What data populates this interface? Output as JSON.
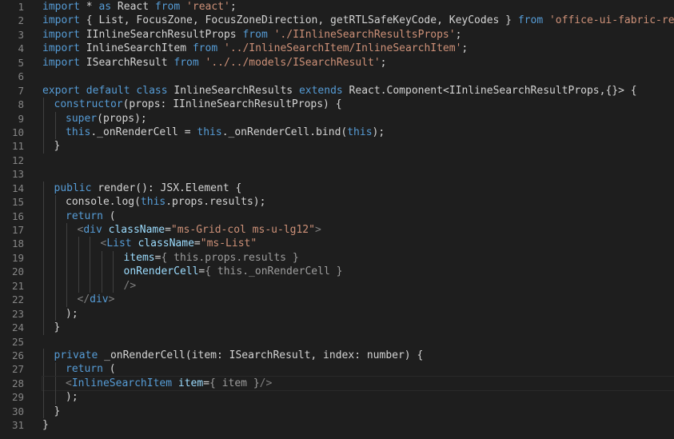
{
  "editor": {
    "lines": [
      {
        "n": "1",
        "indent": 0,
        "tokens": [
          [
            "kw",
            "import"
          ],
          [
            "plain",
            " * "
          ],
          [
            "kw",
            "as"
          ],
          [
            "plain",
            " React "
          ],
          [
            "kw",
            "from"
          ],
          [
            "plain",
            " "
          ],
          [
            "str",
            "'react'"
          ],
          [
            "plain",
            ";"
          ]
        ]
      },
      {
        "n": "2",
        "indent": 0,
        "tokens": [
          [
            "kw",
            "import"
          ],
          [
            "plain",
            " { List, FocusZone, FocusZoneDirection, getRTLSafeKeyCode, KeyCodes } "
          ],
          [
            "kw",
            "from"
          ],
          [
            "plain",
            " "
          ],
          [
            "str",
            "'office-ui-fabric-react'"
          ],
          [
            "plain",
            ";"
          ]
        ]
      },
      {
        "n": "3",
        "indent": 0,
        "tokens": [
          [
            "kw",
            "import"
          ],
          [
            "plain",
            " IInlineSearchResultProps "
          ],
          [
            "kw",
            "from"
          ],
          [
            "plain",
            " "
          ],
          [
            "str",
            "'./IInlineSearchResultsProps'"
          ],
          [
            "plain",
            ";"
          ]
        ]
      },
      {
        "n": "4",
        "indent": 0,
        "tokens": [
          [
            "kw",
            "import"
          ],
          [
            "plain",
            " InlineSearchItem "
          ],
          [
            "kw",
            "from"
          ],
          [
            "plain",
            " "
          ],
          [
            "str",
            "'../InlineSearchItem/InlineSearchItem'"
          ],
          [
            "plain",
            ";"
          ]
        ]
      },
      {
        "n": "5",
        "indent": 0,
        "tokens": [
          [
            "kw",
            "import"
          ],
          [
            "plain",
            " ISearchResult "
          ],
          [
            "kw",
            "from"
          ],
          [
            "plain",
            " "
          ],
          [
            "str",
            "'../../models/ISearchResult'"
          ],
          [
            "plain",
            ";"
          ]
        ]
      },
      {
        "n": "6",
        "indent": 0,
        "tokens": []
      },
      {
        "n": "7",
        "indent": 0,
        "tokens": [
          [
            "kw",
            "export"
          ],
          [
            "plain",
            " "
          ],
          [
            "kw",
            "default"
          ],
          [
            "plain",
            " "
          ],
          [
            "kw",
            "class"
          ],
          [
            "plain",
            " InlineSearchResults "
          ],
          [
            "kw",
            "extends"
          ],
          [
            "plain",
            " React.Component<IInlineSearchResultProps,{}> {"
          ]
        ]
      },
      {
        "n": "8",
        "indent": 1,
        "tokens": [
          [
            "kw",
            "constructor"
          ],
          [
            "plain",
            "(props: IInlineSearchResultProps) {"
          ]
        ]
      },
      {
        "n": "9",
        "indent": 2,
        "tokens": [
          [
            "kw",
            "super"
          ],
          [
            "plain",
            "(props);"
          ]
        ]
      },
      {
        "n": "10",
        "indent": 2,
        "tokens": [
          [
            "kw",
            "this"
          ],
          [
            "plain",
            "._onRenderCell = "
          ],
          [
            "kw",
            "this"
          ],
          [
            "plain",
            "._onRenderCell.bind("
          ],
          [
            "kw",
            "this"
          ],
          [
            "plain",
            ");"
          ]
        ]
      },
      {
        "n": "11",
        "indent": 1,
        "tokens": [
          [
            "plain",
            "}"
          ]
        ]
      },
      {
        "n": "12",
        "indent": 0,
        "tokens": []
      },
      {
        "n": "13",
        "indent": 0,
        "tokens": []
      },
      {
        "n": "14",
        "indent": 1,
        "tokens": [
          [
            "kw",
            "public"
          ],
          [
            "plain",
            " render(): JSX.Element {"
          ]
        ]
      },
      {
        "n": "15",
        "indent": 2,
        "tokens": [
          [
            "plain",
            "console.log("
          ],
          [
            "kw",
            "this"
          ],
          [
            "plain",
            ".props.results);"
          ]
        ]
      },
      {
        "n": "16",
        "indent": 2,
        "tokens": [
          [
            "kw",
            "return"
          ],
          [
            "plain",
            " ("
          ]
        ]
      },
      {
        "n": "17",
        "indent": 3,
        "tokens": [
          [
            "tagb",
            "<"
          ],
          [
            "tag",
            "div"
          ],
          [
            "plain",
            " "
          ],
          [
            "attr",
            "className"
          ],
          [
            "plain",
            "="
          ],
          [
            "str",
            "\"ms-Grid-col ms-u-lg12\""
          ],
          [
            "tagb",
            ">"
          ]
        ]
      },
      {
        "n": "18",
        "indent": 5,
        "tokens": [
          [
            "tagb",
            "<"
          ],
          [
            "tag",
            "List"
          ],
          [
            "plain",
            " "
          ],
          [
            "attr",
            "className"
          ],
          [
            "plain",
            "="
          ],
          [
            "str",
            "\"ms-List\""
          ]
        ]
      },
      {
        "n": "19",
        "indent": 7,
        "tokens": [
          [
            "attr",
            "items"
          ],
          [
            "plain",
            "="
          ],
          [
            "dim",
            "{ this.props.results }"
          ]
        ]
      },
      {
        "n": "20",
        "indent": 7,
        "tokens": [
          [
            "attr",
            "onRenderCell"
          ],
          [
            "plain",
            "="
          ],
          [
            "dim",
            "{ this._onRenderCell }"
          ]
        ]
      },
      {
        "n": "21",
        "indent": 7,
        "tokens": [
          [
            "tagb",
            "/>"
          ]
        ]
      },
      {
        "n": "22",
        "indent": 3,
        "tokens": [
          [
            "tagb",
            "</"
          ],
          [
            "tag",
            "div"
          ],
          [
            "tagb",
            ">"
          ]
        ]
      },
      {
        "n": "23",
        "indent": 2,
        "tokens": [
          [
            "plain",
            ");"
          ]
        ]
      },
      {
        "n": "24",
        "indent": 1,
        "tokens": [
          [
            "plain",
            "}"
          ]
        ]
      },
      {
        "n": "25",
        "indent": 0,
        "tokens": []
      },
      {
        "n": "26",
        "indent": 1,
        "tokens": [
          [
            "kw",
            "private"
          ],
          [
            "plain",
            " _onRenderCell(item: ISearchResult, index: number) {"
          ]
        ]
      },
      {
        "n": "27",
        "indent": 2,
        "tokens": [
          [
            "kw",
            "return"
          ],
          [
            "plain",
            " ("
          ]
        ]
      },
      {
        "n": "28",
        "indent": 2,
        "cursor": true,
        "tokens": [
          [
            "tagb",
            "<"
          ],
          [
            "tag",
            "InlineSearchItem"
          ],
          [
            "plain",
            " "
          ],
          [
            "attr",
            "item"
          ],
          [
            "plain",
            "="
          ],
          [
            "dim",
            "{ item }"
          ],
          [
            "tagb",
            "/>"
          ]
        ]
      },
      {
        "n": "29",
        "indent": 2,
        "tokens": [
          [
            "plain",
            ");"
          ]
        ]
      },
      {
        "n": "30",
        "indent": 1,
        "tokens": [
          [
            "plain",
            "}"
          ]
        ]
      },
      {
        "n": "31",
        "indent": 0,
        "tokens": [
          [
            "plain",
            "}"
          ]
        ]
      }
    ]
  }
}
